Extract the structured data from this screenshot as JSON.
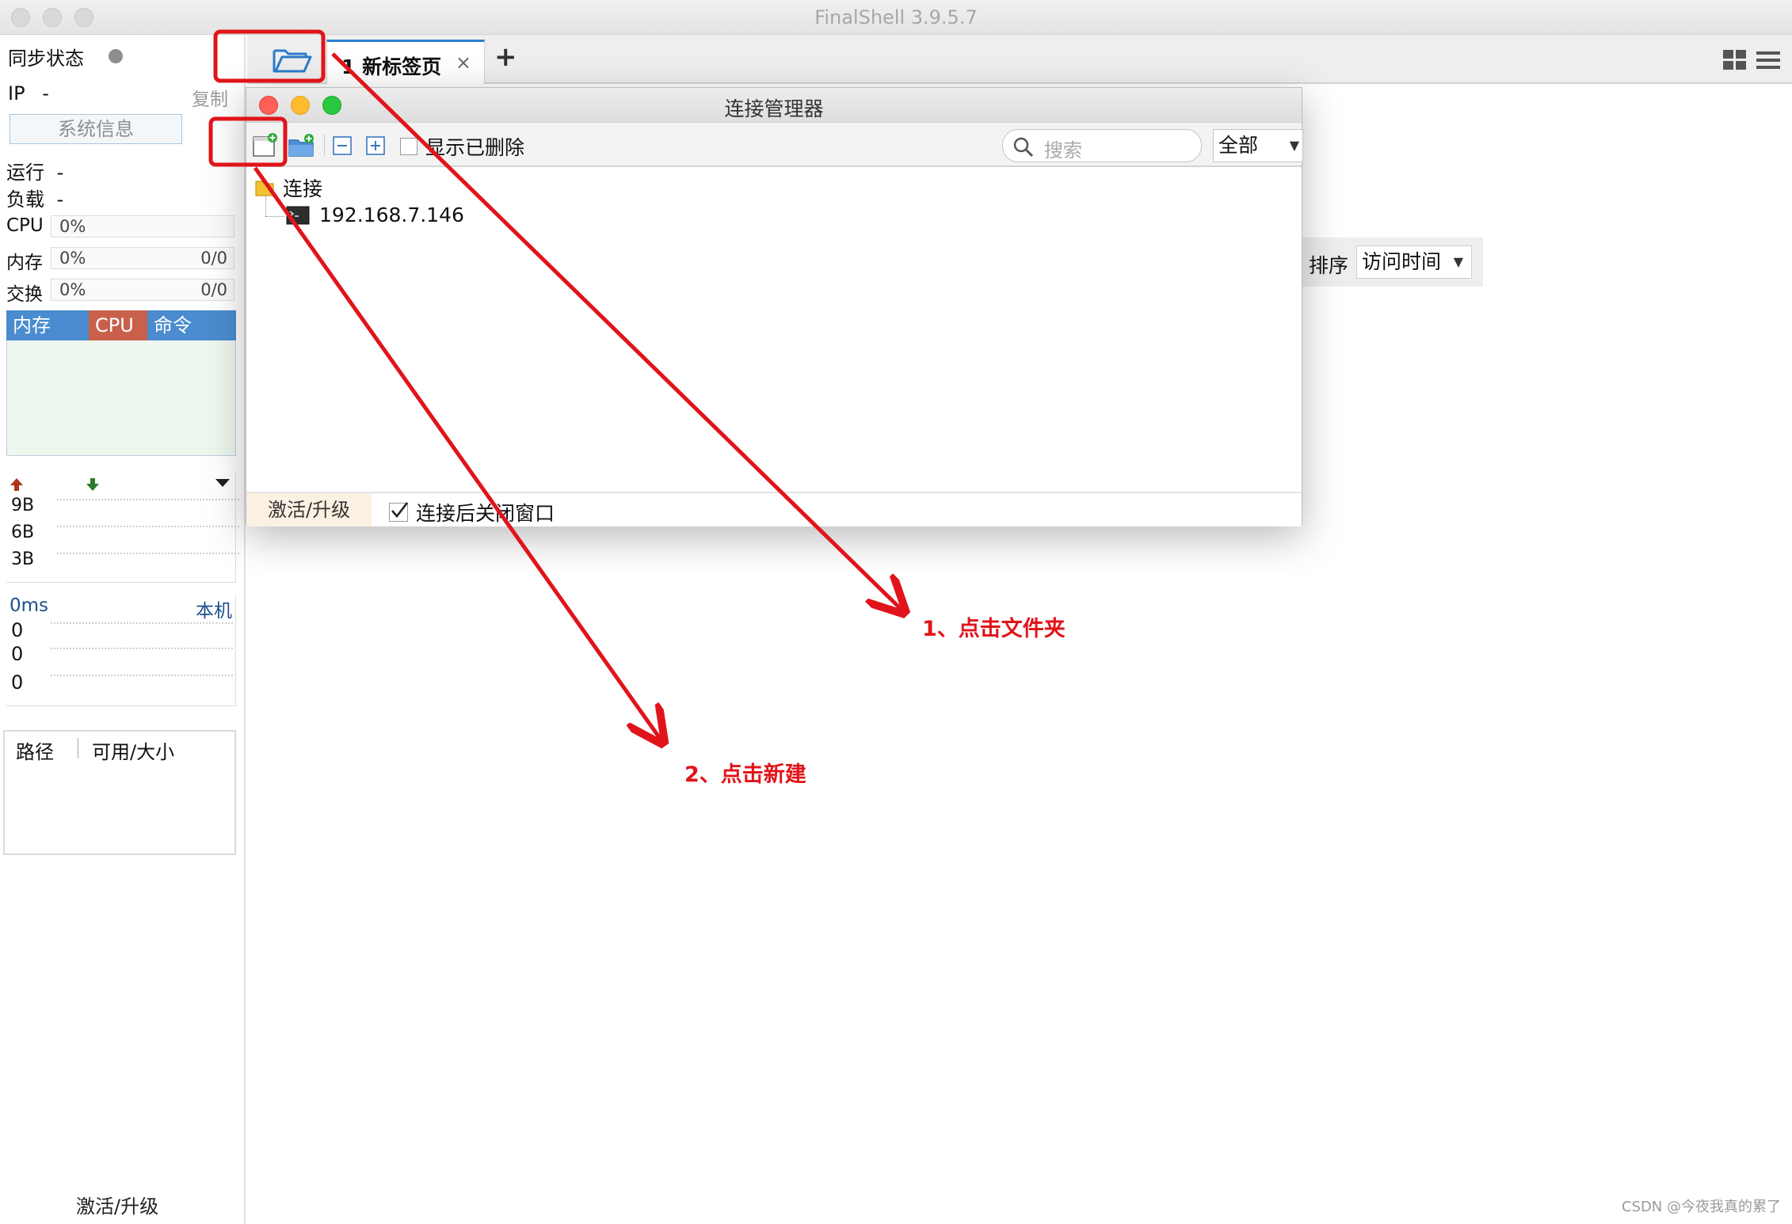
{
  "window": {
    "title": "FinalShell 3.9.5.7"
  },
  "sidebar": {
    "sync_label": "同步状态",
    "ip_label": "IP",
    "ip_value": "-",
    "copy_label": "复制",
    "sysinfo_label": "系统信息",
    "uptime_label": "运行",
    "uptime_value": "-",
    "load_label": "负载",
    "load_value": "-",
    "meters": [
      {
        "label": "CPU",
        "value": "0%",
        "right": ""
      },
      {
        "label": "内存",
        "value": "0%",
        "right": "0/0"
      },
      {
        "label": "交换",
        "value": "0%",
        "right": "0/0"
      }
    ],
    "chart_tabs": [
      {
        "label": "内存",
        "color": "#4a8ccf"
      },
      {
        "label": "CPU",
        "color": "#c9604c"
      },
      {
        "label": "命令",
        "color": "#4a8ccf"
      }
    ],
    "net_labels": [
      "9B",
      "6B",
      "3B"
    ],
    "ping_label": "0ms",
    "ping_host": "本机",
    "ping_values": [
      "0",
      "0",
      "0"
    ],
    "disk_headers": {
      "path": "路径",
      "size": "可用/大小"
    },
    "activate_label": "激活/升级"
  },
  "tabbar": {
    "tab_label": "1 新标签页",
    "close_glyph": "×",
    "add_glyph": "+"
  },
  "sortbar": {
    "label": "排序",
    "selected": "访问时间"
  },
  "dialog": {
    "title": "连接管理器",
    "show_deleted_label": "显示已删除",
    "search_placeholder": "搜索",
    "filter_selected": "全部",
    "tree": {
      "folder_label": "连接",
      "host_label": "192.168.7.146"
    },
    "footer": {
      "activate_label": "激活/升级",
      "close_after_connect_label": "连接后关闭窗口"
    }
  },
  "annotations": {
    "step1": "1、点击文件夹",
    "step2": "2、点击新建",
    "color": "#e0141a"
  },
  "watermark": "CSDN @今夜我真的累了"
}
